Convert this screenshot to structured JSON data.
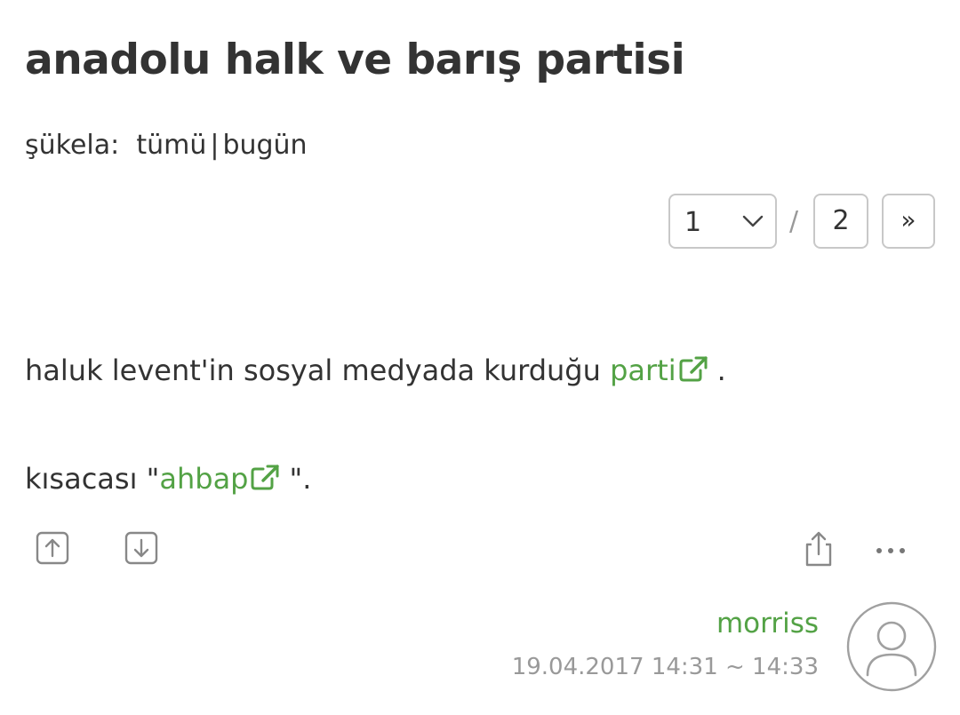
{
  "topic": {
    "title": "anadolu halk ve barış partisi"
  },
  "sukela": {
    "label": "şükela:",
    "all": "tümü",
    "separator": "|",
    "today": "bugün"
  },
  "pager": {
    "current": "1",
    "separator": "/",
    "total": "2",
    "next": "»"
  },
  "entry": {
    "line1": {
      "text": "haluk levent'in sosyal medyada kurduğu",
      "link": "parti",
      "after": "."
    },
    "line2": {
      "before": "kısacası \"",
      "link": "ahbap",
      "after": "\"."
    },
    "author": "morriss",
    "date": "19.04.2017 14:31 ~ 14:33"
  },
  "icons": {
    "vote_up": "arrow-up-square-icon",
    "vote_down": "arrow-down-square-icon",
    "share": "share-icon",
    "more": "more-dots-icon",
    "external_link": "external-link-icon",
    "avatar": "user-avatar-icon"
  },
  "colors": {
    "link": "#53a245",
    "text": "#333333",
    "muted": "#999999",
    "border": "#c8c8c8"
  }
}
